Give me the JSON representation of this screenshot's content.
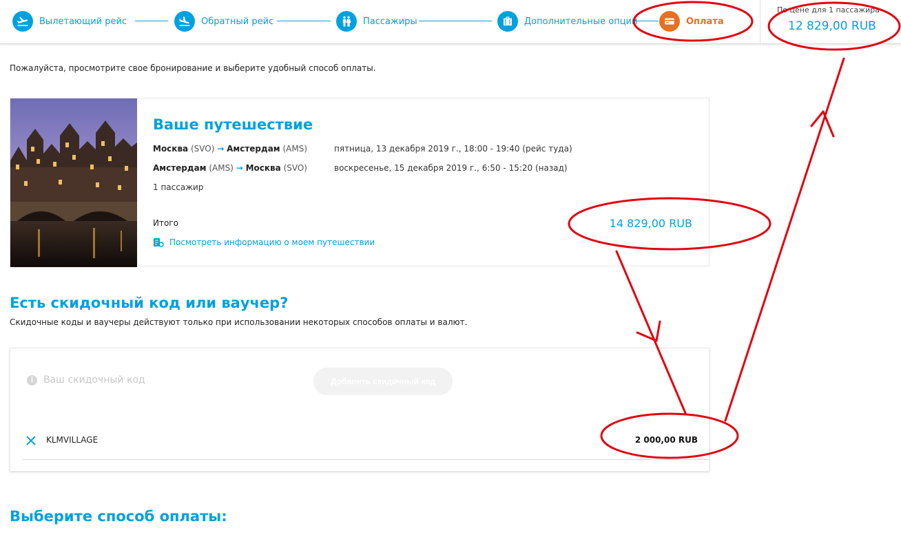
{
  "steps": [
    {
      "label": "Вылетающий рейс",
      "icon": "plane-departure-icon"
    },
    {
      "label": "Обратный рейс",
      "icon": "plane-arrival-icon"
    },
    {
      "label": "Пассажиры",
      "icon": "passengers-icon"
    },
    {
      "label": "Дополнительные опции",
      "icon": "luggage-icon"
    },
    {
      "label": "Оплата",
      "icon": "credit-card-icon",
      "active": true
    }
  ],
  "price_box": {
    "caption": "По цене для 1 пассажира",
    "value": "12 829,00 RUB"
  },
  "intro": "Пожалуйста, просмотрите свое бронирование и выберите удобный способ оплаты.",
  "trip": {
    "title": "Ваше путешествие",
    "legs": [
      {
        "from_city": "Москва",
        "from_code": "(SVO)",
        "to_city": "Амстердам",
        "to_code": "(AMS)",
        "date": "пятница, 13 декабря 2019 г., 18:00 - 19:40 (рейс туда)"
      },
      {
        "from_city": "Амстердам",
        "from_code": "(AMS)",
        "to_city": "Москва",
        "to_code": "(SVO)",
        "date": "воскресенье, 15 декабря 2019 г., 6:50 - 15:20 (назад)"
      }
    ],
    "passengers": "1 пассажир",
    "total_label": "Итого",
    "total_value": "14 829,00 RUB",
    "details_link": "Посмотреть информацию о моем путешествии"
  },
  "discount": {
    "title": "Есть скидочный код или ваучер?",
    "subtitle": "Скидочные коды и ваучеры действуют только при использовании некоторых способов оплаты и валют.",
    "input_placeholder": "Ваш скидочный код",
    "add_button": "Добавить скидочный код",
    "applied_code": "KLMVILLAGE",
    "applied_amount": "2 000,00 RUB"
  },
  "payment_title": "Выберите способ оплаты:",
  "colors": {
    "accent": "#00a1de",
    "active_step": "#e37222",
    "annotation": "#e3000f"
  }
}
